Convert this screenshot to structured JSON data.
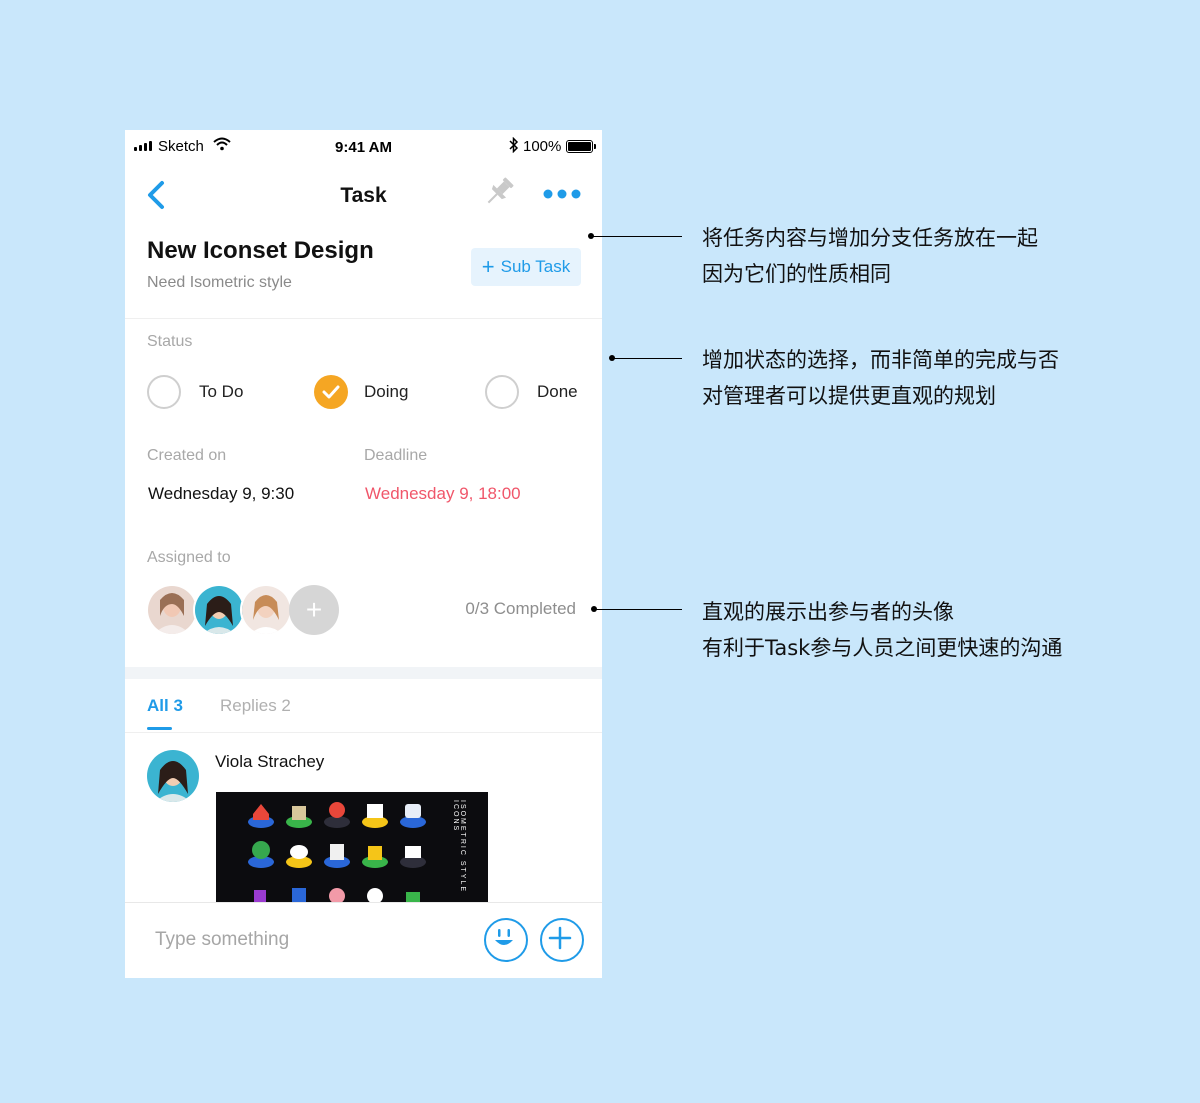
{
  "status_bar": {
    "carrier": "Sketch",
    "time": "9:41 AM",
    "battery": "100%"
  },
  "nav": {
    "title": "Task"
  },
  "task": {
    "title": "New Iconset Design",
    "subtitle": "Need Isometric style",
    "subtask_label": "Sub Task"
  },
  "status": {
    "label": "Status",
    "options": [
      {
        "label": "To Do",
        "checked": false
      },
      {
        "label": "Doing",
        "checked": true
      },
      {
        "label": "Done",
        "checked": false
      }
    ]
  },
  "dates": {
    "created_label": "Created on",
    "created_value": "Wednesday 9, 9:30",
    "deadline_label": "Deadline",
    "deadline_value": "Wednesday 9, 18:00"
  },
  "assigned": {
    "label": "Assigned to",
    "add_label": "+",
    "completed": "0/3 Completed"
  },
  "tabs": [
    {
      "label": "All 3",
      "active": true
    },
    {
      "label": "Replies 2",
      "active": false
    }
  ],
  "comment": {
    "author": "Viola Strachey",
    "image_caption": "ISOMETRIC STYLE ICONS"
  },
  "composer": {
    "placeholder": "Type something"
  },
  "annotations": [
    {
      "lines": [
        "将任务内容与增加分支任务放在一起",
        "因为它们的性质相同"
      ]
    },
    {
      "lines": [
        "增加状态的选择，而非简单的完成与否",
        "对管理者可以提供更直观的规划"
      ]
    },
    {
      "lines": [
        "直观的展示出参与者的头像",
        "有利于Task参与人员之间更快速的沟通"
      ]
    }
  ],
  "colors": {
    "accent": "#1f9be8",
    "doing": "#f5a623",
    "deadline": "#f0566a",
    "background": "#c9e7fb"
  }
}
